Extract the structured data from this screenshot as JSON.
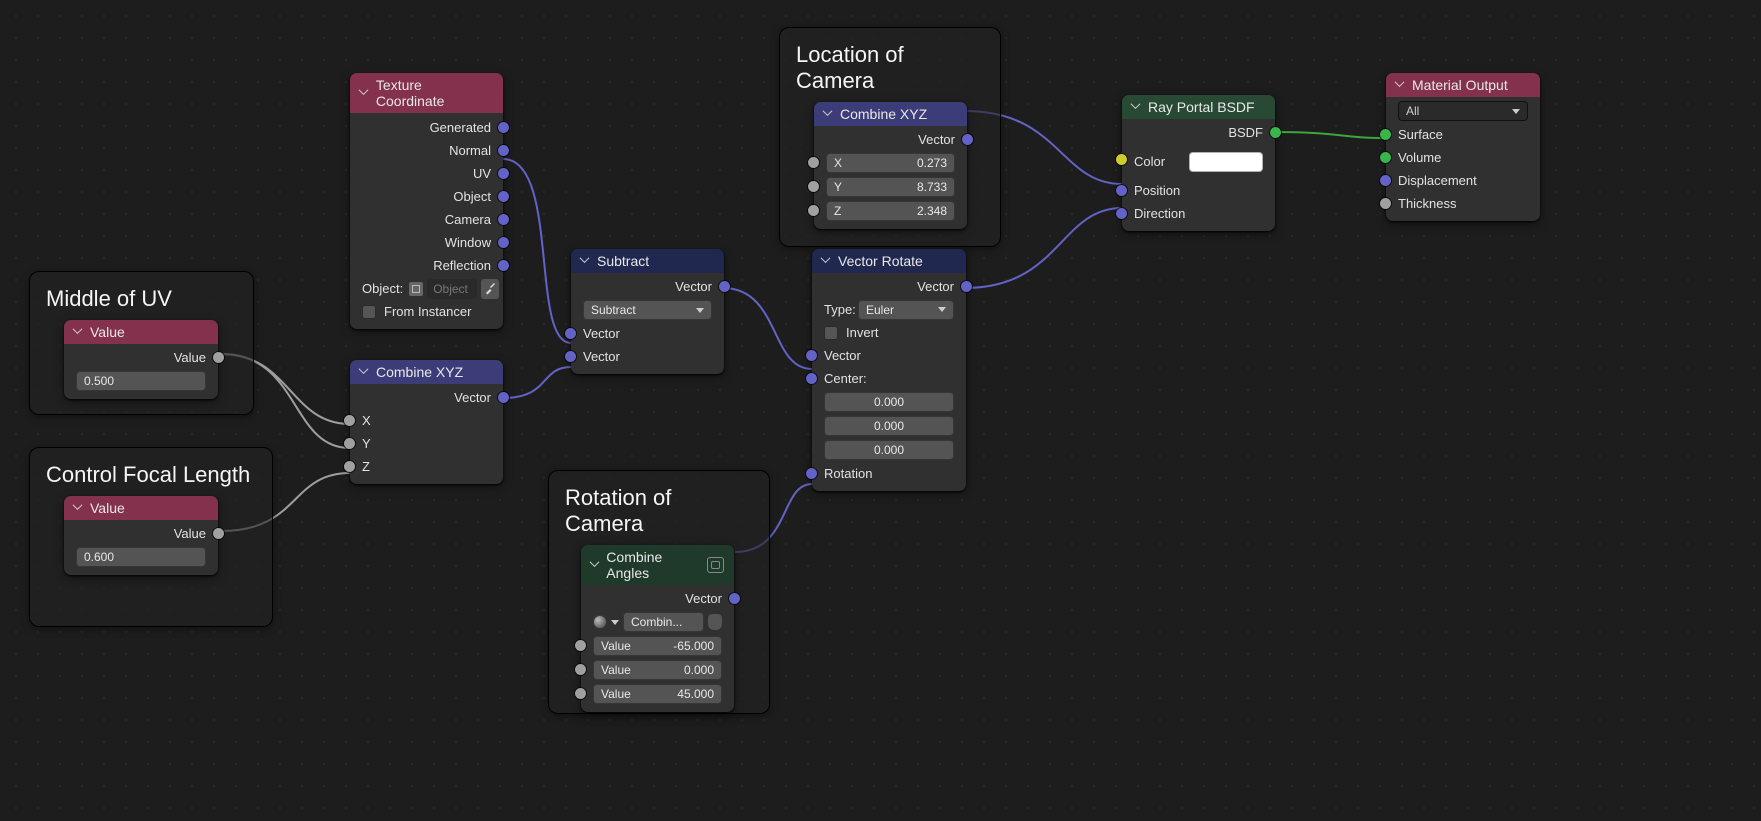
{
  "frames": {
    "middle_of_uv": {
      "title": "Middle of UV"
    },
    "focal": {
      "title": "Control Focal Length"
    },
    "loc_cam": {
      "title": "Location of Camera"
    },
    "rot_cam": {
      "title": "Rotation of Camera"
    }
  },
  "value1": {
    "header": "Value",
    "out_label": "Value",
    "value": "0.500"
  },
  "value2": {
    "header": "Value",
    "out_label": "Value",
    "value": "0.600"
  },
  "texcoord": {
    "header": "Texture Coordinate",
    "outs": [
      "Generated",
      "Normal",
      "UV",
      "Object",
      "Camera",
      "Window",
      "Reflection"
    ],
    "object_label": "Object:",
    "object_placeholder": "Object",
    "from_instancer": "From Instancer"
  },
  "combine_low": {
    "header": "Combine XYZ",
    "out": "Vector",
    "ins": [
      "X",
      "Y",
      "Z"
    ]
  },
  "subtract": {
    "header": "Subtract",
    "out": "Vector",
    "mode": "Subtract",
    "ins": [
      "Vector",
      "Vector"
    ]
  },
  "loc_combine": {
    "header": "Combine XYZ",
    "out": "Vector",
    "rows": [
      {
        "k": "X",
        "v": "0.273"
      },
      {
        "k": "Y",
        "v": "8.733"
      },
      {
        "k": "Z",
        "v": "2.348"
      }
    ]
  },
  "vrotate": {
    "header": "Vector Rotate",
    "out": "Vector",
    "type_label": "Type:",
    "type": "Euler",
    "invert": "Invert",
    "vector_in": "Vector",
    "center_label": "Center:",
    "center": [
      "0.000",
      "0.000",
      "0.000"
    ],
    "rotation_in": "Rotation"
  },
  "rot_combine": {
    "header": "Combine Angles",
    "out": "Vector",
    "chip": "Combin...",
    "rows": [
      {
        "k": "Value",
        "v": "-65.000"
      },
      {
        "k": "Value",
        "v": "0.000"
      },
      {
        "k": "Value",
        "v": "45.000"
      }
    ]
  },
  "rayportal": {
    "header": "Ray Portal BSDF",
    "out": "BSDF",
    "color": "Color",
    "position": "Position",
    "direction": "Direction"
  },
  "matout": {
    "header": "Material Output",
    "target": "All",
    "surface": "Surface",
    "volume": "Volume",
    "displacement": "Displacement",
    "thickness": "Thickness"
  }
}
